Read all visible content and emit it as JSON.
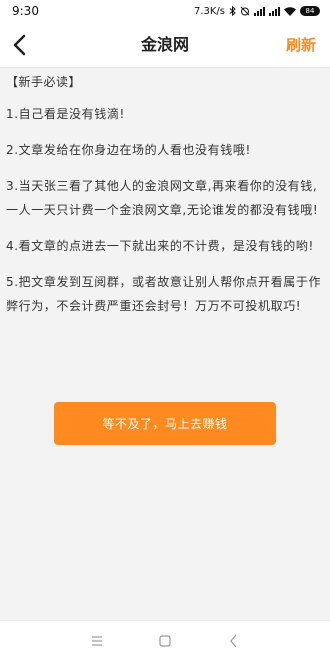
{
  "status_bar": {
    "time": "9:30",
    "net_speed": "7.3K/s",
    "battery": "84"
  },
  "header": {
    "title": "金浪网",
    "refresh_label": "刷新"
  },
  "content": {
    "section_title": "【新手必读】",
    "rules": [
      "1.自己看是没有钱滴!",
      "2.文章发给在你身边在场的人看也没有钱哦!",
      "3.当天张三看了其他人的金浪网文章,再来看你的没有钱,一人一天只计费一个金浪网文章,无论谁发的都没有钱哦!",
      "4.看文章的点进去一下就出来的不计费，是没有钱的哟!",
      "5.把文章发到互阅群，或者故意让别人帮你点开看属于作弊行为，不会计费严重还会封号！万万不可投机取巧!"
    ]
  },
  "cta_label": "等不及了，马上去赚钱",
  "colors": {
    "accent": "#ff8a1f",
    "background": "#f3f3f3",
    "text": "#333333"
  },
  "icons": {
    "back": "chevron-left-icon",
    "nav_menu": "menu-icon",
    "nav_home": "square-home-icon",
    "nav_back": "triangle-back-icon"
  }
}
